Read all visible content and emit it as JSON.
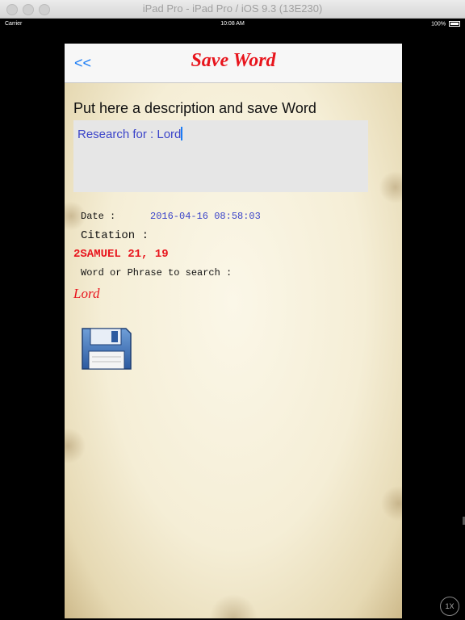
{
  "window": {
    "title": "iPad Pro - iPad Pro / iOS 9.3 (13E230)"
  },
  "status_bar": {
    "carrier": "Carrier",
    "time": "10:08 AM",
    "battery": "100%"
  },
  "nav": {
    "back_label": "<<",
    "title": "Save Word"
  },
  "form": {
    "description_label": "Put here a description and save Word",
    "description_value": "Research for : Lord",
    "date_label": "Date :",
    "date_value": "2016-04-16 08:58:03",
    "citation_label": "Citation :",
    "citation_value": "2SAMUEL 21, 19",
    "word_label": "Word or Phrase to search :",
    "word_value": "Lord"
  },
  "save_button": {
    "icon": "floppy-disk-icon"
  },
  "zoom_badge": "1X",
  "colors": {
    "title_red": "#e8141c",
    "link_blue": "#1a7cf5",
    "value_blue": "#3b44c9"
  }
}
